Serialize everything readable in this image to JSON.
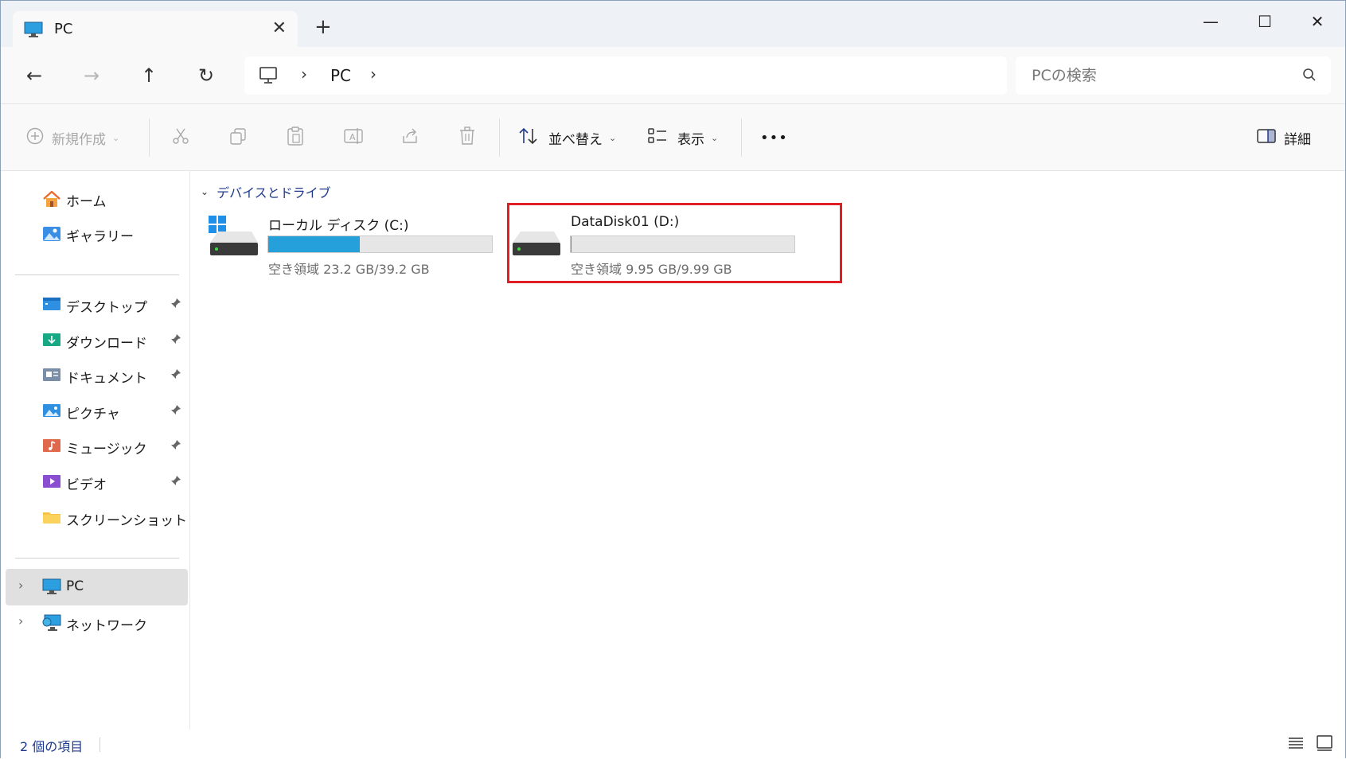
{
  "window": {
    "tab_title": "PC",
    "tab_close": "✕",
    "new_tab": "+",
    "minimize": "—",
    "maximize": "☐",
    "close": "✕"
  },
  "nav": {
    "back": "←",
    "forward": "→",
    "up": "↑",
    "refresh": "↻",
    "breadcrumb": [
      "PC"
    ],
    "separator": "›",
    "search_placeholder": "PCの検索"
  },
  "toolbar": {
    "new": "新規作成",
    "sort": "並べ替え",
    "view": "表示",
    "more": "•••",
    "details": "詳細"
  },
  "sidebar": {
    "top_items": [
      {
        "label": "ホーム",
        "icon": "home-icon"
      },
      {
        "label": "ギャラリー",
        "icon": "gallery-icon"
      }
    ],
    "pinned_items": [
      {
        "label": "デスクトップ",
        "icon": "desktop-folder-icon",
        "pinned": true
      },
      {
        "label": "ダウンロード",
        "icon": "downloads-folder-icon",
        "pinned": true
      },
      {
        "label": "ドキュメント",
        "icon": "documents-folder-icon",
        "pinned": true
      },
      {
        "label": "ピクチャ",
        "icon": "pictures-folder-icon",
        "pinned": true
      },
      {
        "label": "ミュージック",
        "icon": "music-folder-icon",
        "pinned": true
      },
      {
        "label": "ビデオ",
        "icon": "videos-folder-icon",
        "pinned": true
      },
      {
        "label": "スクリーンショット",
        "icon": "folder-icon",
        "pinned": false
      }
    ],
    "bottom_items": [
      {
        "label": "PC",
        "icon": "pc-icon",
        "selected": true
      },
      {
        "label": "ネットワーク",
        "icon": "network-icon",
        "selected": false
      }
    ],
    "pin_glyph": "📌",
    "expand_glyph": "›"
  },
  "content": {
    "group_title": "デバイスとドライブ",
    "drives": [
      {
        "name": "ローカル ディスク (C:)",
        "free": "空き領域 23.2 GB/39.2 GB",
        "used_fraction": 0.41,
        "system": true
      },
      {
        "name": "DataDisk01 (D:)",
        "free": "空き領域 9.95 GB/9.99 GB",
        "used_fraction": 0.004,
        "system": false
      }
    ]
  },
  "status": {
    "item_count": "2 個の項目"
  },
  "colors": {
    "accent": "#26a0da",
    "highlight": "#e01e26",
    "link_blue": "#1f3a8a"
  }
}
